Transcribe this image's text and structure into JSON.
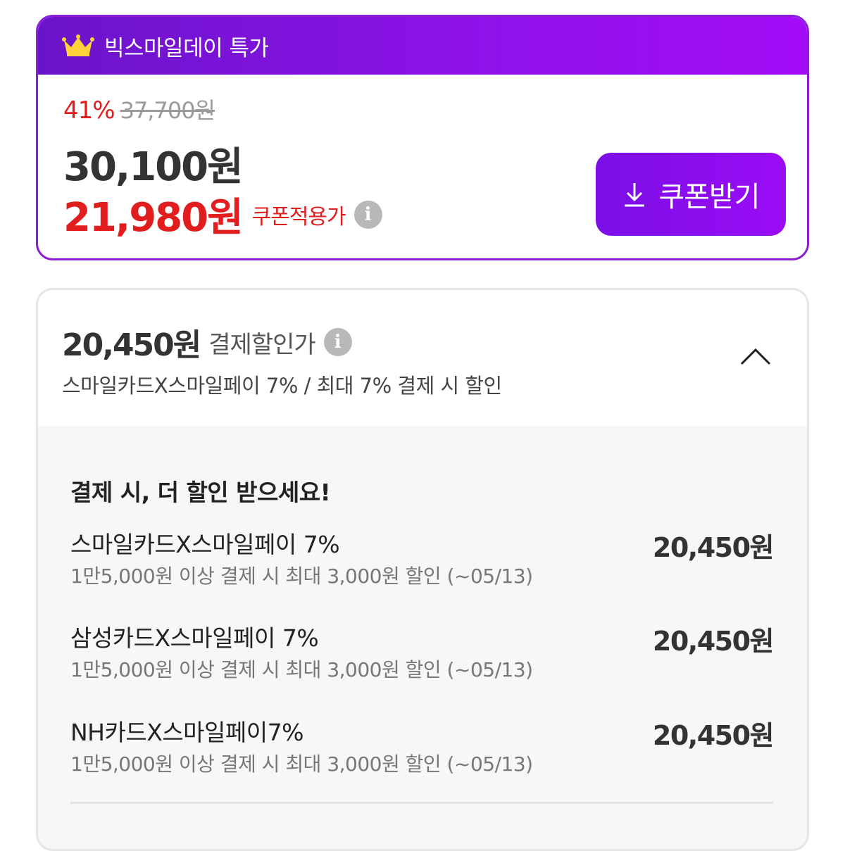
{
  "deal": {
    "title": "빅스마일데이 특가",
    "discount_rate": "41%",
    "original_price": "37,700원",
    "sale_price": "30,100원",
    "coupon_price": "21,980원",
    "coupon_label": "쿠폰적용가",
    "coupon_button": "쿠폰받기"
  },
  "payment": {
    "price": "20,450원",
    "label": "결제할인가",
    "description": "스마일카드X스마일페이 7% / 최대 7% 결제 시 할인",
    "more_title": "결제 시, 더 할인 받으세요!",
    "offers": [
      {
        "name": "스마일카드X스마일페이 7%",
        "condition": "1만5,000원 이상 결제 시 최대 3,000원 할인 (~05/13)",
        "price": "20,450원"
      },
      {
        "name": "삼성카드X스마일페이 7%",
        "condition": "1만5,000원 이상 결제 시 최대 3,000원 할인 (~05/13)",
        "price": "20,450원"
      },
      {
        "name": "NH카드X스마일페이7%",
        "condition": "1만5,000원 이상 결제 시 최대 3,000원 할인 (~05/13)",
        "price": "20,450원"
      }
    ]
  },
  "icons": {
    "crown": "crown-icon",
    "info": "info-icon",
    "download": "download-icon",
    "collapse": "chevron-up-icon"
  },
  "colors": {
    "accent_purple": "#8a1fd6",
    "discount_red": "#e11d1d"
  }
}
